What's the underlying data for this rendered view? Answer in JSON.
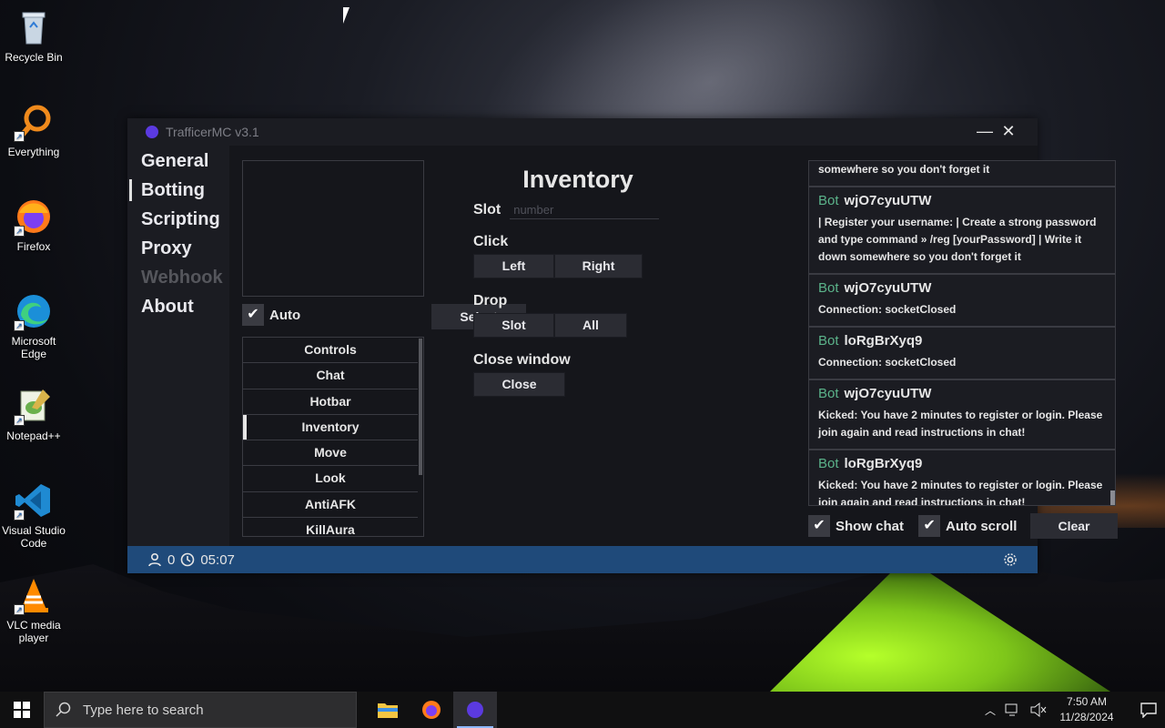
{
  "desktop": {
    "icons": [
      {
        "label": "Recycle Bin"
      },
      {
        "label": "Everything"
      },
      {
        "label": "Firefox"
      },
      {
        "label": "Microsoft Edge"
      },
      {
        "label": "Notepad++"
      },
      {
        "label": "Visual Studio Code"
      },
      {
        "label": "VLC media player"
      }
    ]
  },
  "app": {
    "title": "TrafficerMC v3.1",
    "nav": [
      "General",
      "Botting",
      "Scripting",
      "Proxy",
      "Webhook",
      "About"
    ],
    "auto_label": "Auto",
    "select_label": "Select",
    "tabs": [
      "Controls",
      "Chat",
      "Hotbar",
      "Inventory",
      "Move",
      "Look",
      "AntiAFK",
      "KillAura"
    ],
    "inventory": {
      "title": "Inventory",
      "slot_label": "Slot",
      "slot_placeholder": "number",
      "click_label": "Click",
      "left_label": "Left",
      "right_label": "Right",
      "drop_label": "Drop",
      "drop_slot_label": "Slot",
      "drop_all_label": "All",
      "close_window_label": "Close window",
      "close_label": "Close"
    },
    "log": {
      "top_partial": "somewhere so you don't forget it",
      "messages": [
        {
          "tag": "Bot",
          "name": "wjO7cyuUTW",
          "text": "| Register your username: | Create a strong password and type command » /reg [yourPassword] | Write it down somewhere so you don't forget it"
        },
        {
          "tag": "Bot",
          "name": "wjO7cyuUTW",
          "text": "Connection: socketClosed"
        },
        {
          "tag": "Bot",
          "name": "loRgBrXyq9",
          "text": "Connection: socketClosed"
        },
        {
          "tag": "Bot",
          "name": "wjO7cyuUTW",
          "text": "Kicked: You have 2 minutes to register or login. Please join again and read instructions in chat!"
        },
        {
          "tag": "Bot",
          "name": "loRgBrXyq9",
          "text": "Kicked: You have 2 minutes to register or login. Please join again and read instructions in chat!"
        }
      ]
    },
    "show_chat_label": "Show chat",
    "auto_scroll_label": "Auto scroll",
    "clear_label": "Clear",
    "status": {
      "bot_count": "0",
      "timer": "05:07"
    }
  },
  "taskbar": {
    "search_placeholder": "Type here to search",
    "time": "7:50 AM",
    "date": "11/28/2024"
  },
  "colors": {
    "accent": "#5b3ae0",
    "statusbar": "#1f4a7a",
    "bot_tag": "#5bb38a"
  }
}
